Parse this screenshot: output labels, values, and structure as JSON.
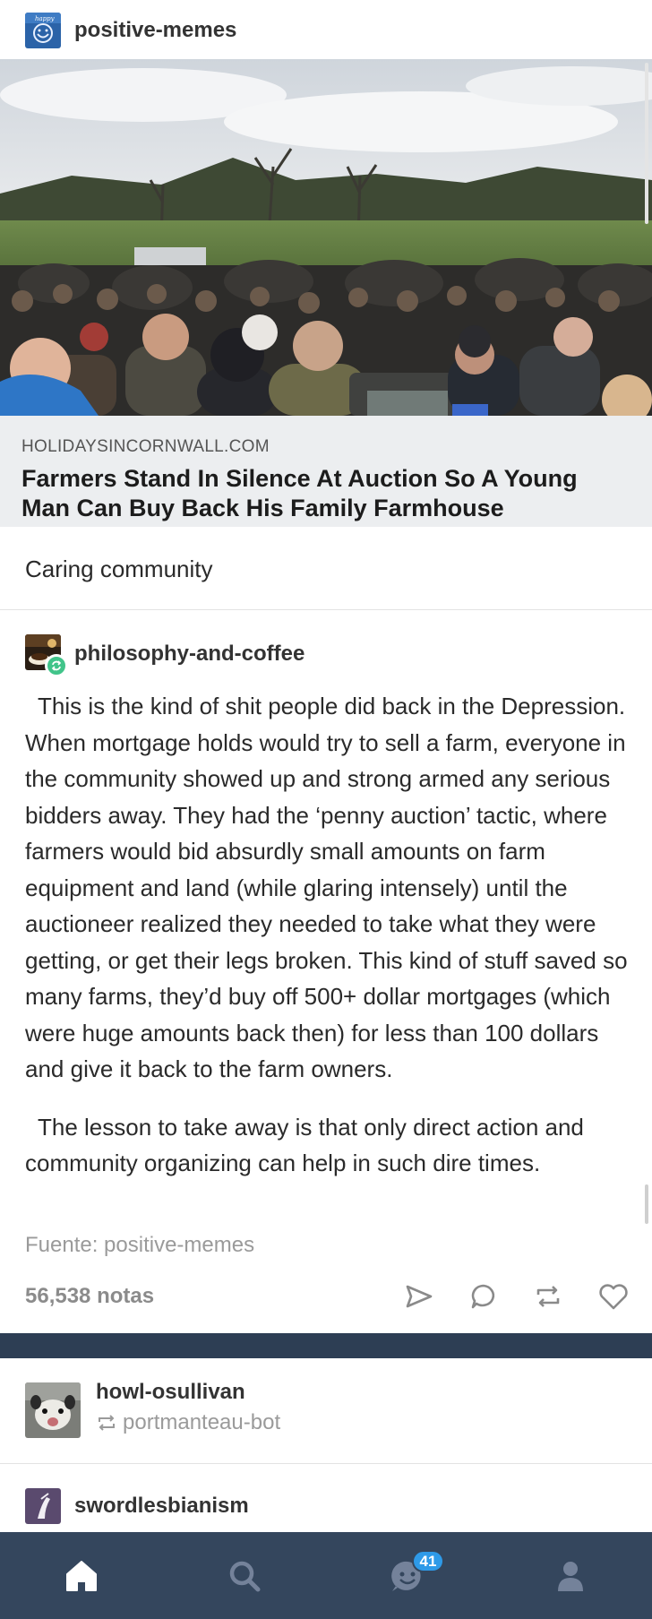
{
  "post": {
    "blog_name": "positive-memes",
    "link": {
      "domain": "HOLIDAYSINCORNWALL.COM",
      "title": "Farmers Stand In Silence At Auction So A Young Man Can Buy Back His Family Farmhouse"
    },
    "caption": "Caring community",
    "avatar_text": "happy"
  },
  "reblog": {
    "blog_name": "philosophy-and-coffee",
    "paragraphs": [
      "This is the kind of shit people did back in the Depression. When mortgage holds would try to sell a farm, everyone in the community showed up and strong armed any serious bidders away. They had the ‘penny auction’ tactic, where farmers would bid absurdly small amounts on farm equipment and land (while glaring intensely) until the auctioneer realized they needed to take what they were getting, or get their legs broken. This kind of stuff saved so many farms, they’d buy off 500+ dollar mortgages (which were huge amounts back then) for less than 100 dollars and give it back to the farm owners.",
      "The lesson to take away is that only direct action and community organizing can help in such dire times."
    ],
    "source": "Fuente: positive-memes",
    "notes": "56,538 notas"
  },
  "next_post": {
    "blog_name": "howl-osullivan",
    "via": "portmanteau-bot"
  },
  "third_post": {
    "blog_name": "swordlesbianism"
  },
  "nav": {
    "activity_badge": "41",
    "items": [
      "home-icon",
      "search-icon",
      "activity-icon",
      "account-icon"
    ]
  },
  "colors": {
    "nav_background": "#34465d",
    "band": "#2d3e54",
    "reblog_badge": "#41c48a",
    "notification_badge": "#2e9ae8",
    "link_card": "#eceef0"
  }
}
